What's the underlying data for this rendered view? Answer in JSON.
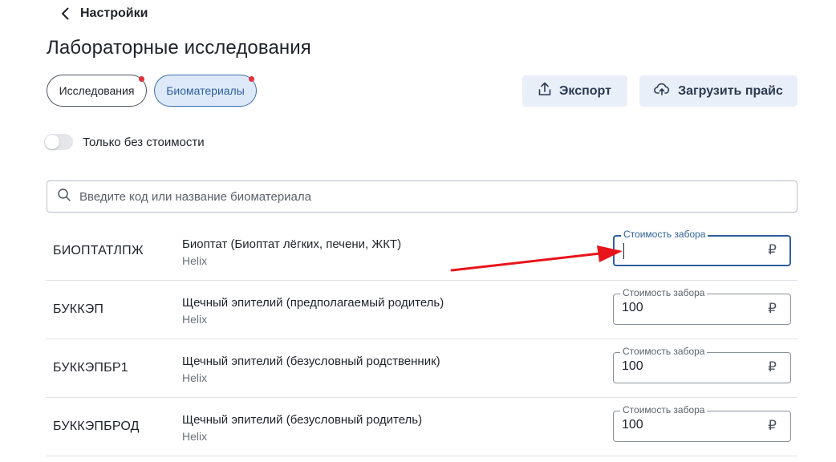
{
  "header": {
    "back_label": "Настройки",
    "page_title": "Лабораторные исследования"
  },
  "tabs": [
    {
      "label": "Исследования",
      "active": false,
      "has_dot": true
    },
    {
      "label": "Биоматериалы",
      "active": true,
      "has_dot": true
    }
  ],
  "actions": {
    "export_label": "Экспорт",
    "upload_label": "Загрузить прайс"
  },
  "filter": {
    "toggle_label": "Только без стоимости",
    "toggle_on": false
  },
  "search": {
    "placeholder": "Введите код или название биоматериала",
    "value": ""
  },
  "price_field_label": "Стоимость забора",
  "currency_symbol": "₽",
  "rows": [
    {
      "code": "БИОПТАТЛПЖ",
      "name": "Биоптат (Биоптат лёгких, печени, ЖКТ)",
      "source": "Helix",
      "price": "",
      "focused": true
    },
    {
      "code": "БУККЭП",
      "name": "Щечный эпителий (предполагаемый родитель)",
      "source": "Helix",
      "price": "100",
      "focused": false
    },
    {
      "code": "БУККЭПБР1",
      "name": "Щечный эпителий (безусловный родственник)",
      "source": "Helix",
      "price": "100",
      "focused": false
    },
    {
      "code": "БУККЭПБРОД",
      "name": "Щечный эпителий (безусловный родитель)",
      "source": "Helix",
      "price": "100",
      "focused": false
    }
  ],
  "colors": {
    "accent": "#2d5f9f",
    "active_tab_bg": "#dde9f8",
    "notification_dot": "#e0323a",
    "annotation_arrow": "#e8141b"
  },
  "icons": {
    "back": "chevron-left-icon",
    "export": "upload-icon",
    "upload": "cloud-upload-icon",
    "search": "search-icon"
  }
}
